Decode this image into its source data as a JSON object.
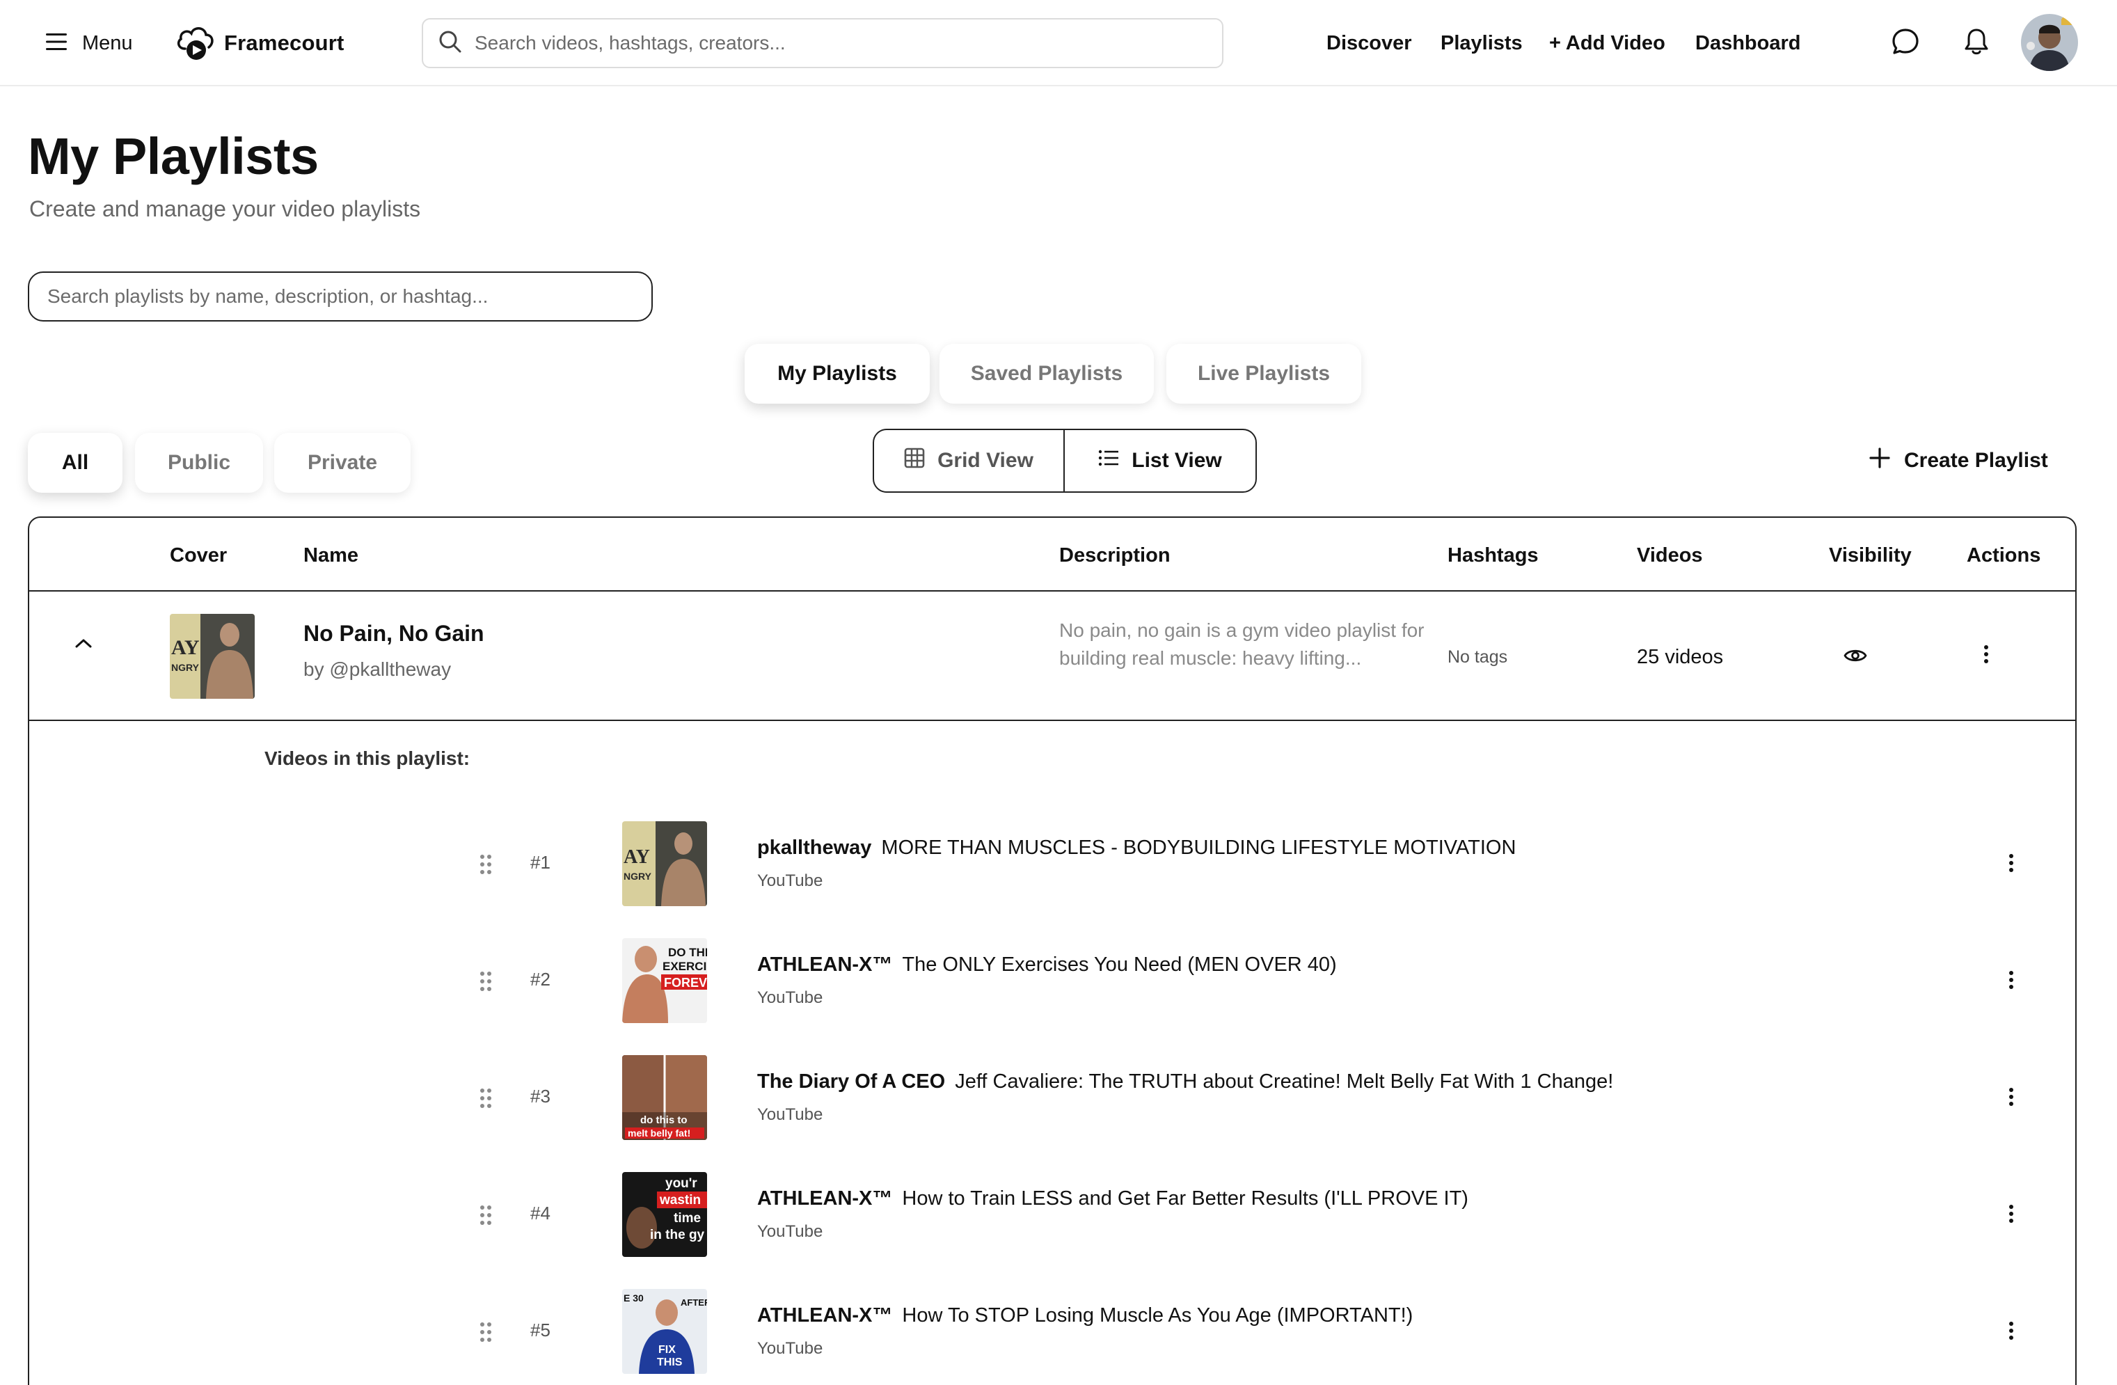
{
  "nav": {
    "menu_label": "Menu",
    "brand_name": "Framecourt",
    "search_placeholder": "Search videos, hashtags, creators...",
    "links": [
      "Discover",
      "Playlists",
      "+ Add Video",
      "Dashboard"
    ]
  },
  "page": {
    "title": "My Playlists",
    "subtitle": "Create and manage your video playlists",
    "search_placeholder": "Search playlists by name, description, or hashtag..."
  },
  "tabs": [
    {
      "label": "My Playlists",
      "active": true
    },
    {
      "label": "Saved Playlists",
      "active": false
    },
    {
      "label": "Live Playlists",
      "active": false
    }
  ],
  "filters": [
    {
      "label": "All",
      "active": true
    },
    {
      "label": "Public",
      "active": false
    },
    {
      "label": "Private",
      "active": false
    }
  ],
  "view_toggle": {
    "grid_label": "Grid View",
    "list_label": "List View",
    "selected": "List View"
  },
  "create_label": "Create Playlist",
  "table": {
    "headers": [
      "Cover",
      "Name",
      "Description",
      "Hashtags",
      "Videos",
      "Visibility",
      "Actions"
    ]
  },
  "playlist": {
    "name": "No Pain, No Gain",
    "owner": "by @pkalltheway",
    "description": "No pain, no gain is a gym video playlist for building real muscle: heavy lifting...",
    "hashtags": "No tags",
    "video_count": "25 videos",
    "visibility_icon": "eye-icon",
    "expanded": true
  },
  "videos_label": "Videos in this playlist:",
  "videos": [
    {
      "num": "#1",
      "creator": "pkalltheway",
      "title": "MORE THAN MUSCLES - BODYBUILDING LIFESTYLE MOTIVATION",
      "source": "YouTube",
      "thumb_text": "AY NGRY"
    },
    {
      "num": "#2",
      "creator": "ATHLEAN-X™",
      "title": "The ONLY Exercises You Need (MEN OVER 40)",
      "source": "YouTube",
      "thumb_text": "DO THI EXERCI FOREV"
    },
    {
      "num": "#3",
      "creator": "The Diary Of A CEO",
      "title": "Jeff Cavaliere: The TRUTH about Creatine! Melt Belly Fat With 1 Change!",
      "source": "YouTube",
      "thumb_text": "do this to melt belly fat!"
    },
    {
      "num": "#4",
      "creator": "ATHLEAN-X™",
      "title": "How to Train LESS and Get Far Better Results (I'LL PROVE IT)",
      "source": "YouTube",
      "thumb_text": "you'r wastin time in the gy"
    },
    {
      "num": "#5",
      "creator": "ATHLEAN-X™",
      "title": "How To STOP Losing Muscle As You Age (IMPORTANT!)",
      "source": "YouTube",
      "thumb_text": "E 30 AFTER 3 FIX THIS"
    }
  ],
  "colors": {
    "border": "#222222",
    "muted": "#666666",
    "accent": "#111111"
  }
}
